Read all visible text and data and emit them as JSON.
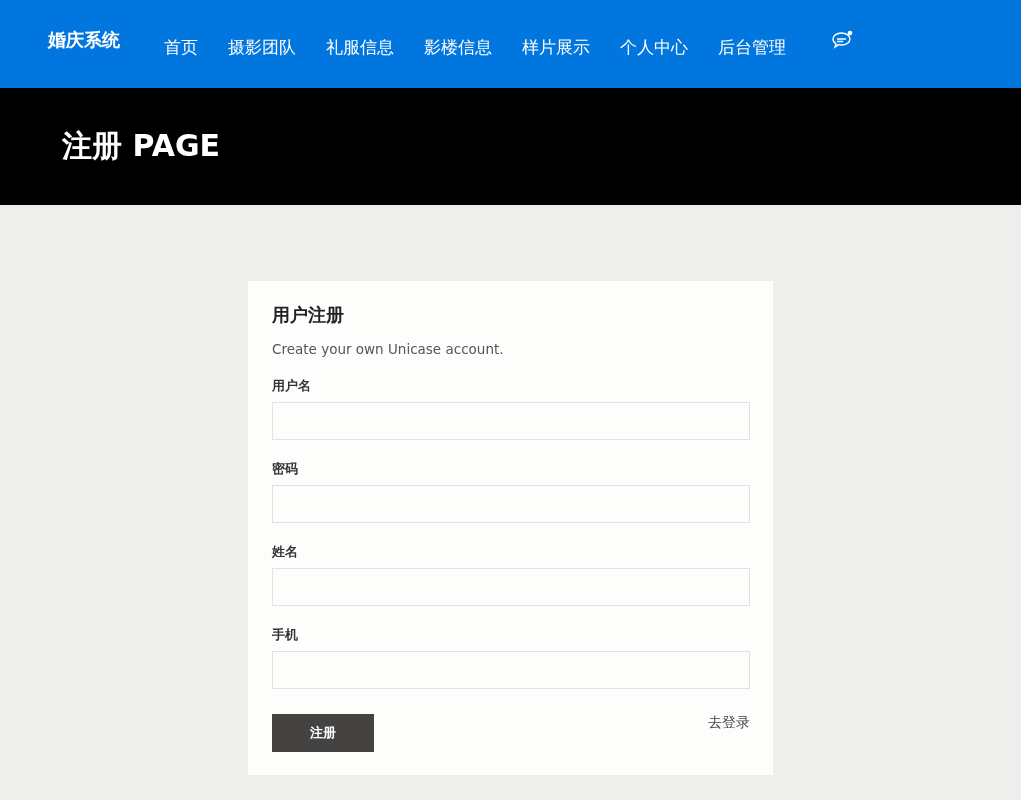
{
  "header": {
    "brand": "婚庆系统",
    "nav": [
      {
        "label": "首页"
      },
      {
        "label": "摄影团队"
      },
      {
        "label": "礼服信息"
      },
      {
        "label": "影楼信息"
      },
      {
        "label": "样片展示"
      },
      {
        "label": "个人中心"
      },
      {
        "label": "后台管理"
      }
    ]
  },
  "banner": {
    "title": "注册 PAGE"
  },
  "form": {
    "title": "用户注册",
    "subtitle": "Create your own Unicase account.",
    "fields": [
      {
        "label": "用户名"
      },
      {
        "label": "密码"
      },
      {
        "label": "姓名"
      },
      {
        "label": "手机"
      }
    ],
    "submit": "注册",
    "login_link": "去登录"
  }
}
